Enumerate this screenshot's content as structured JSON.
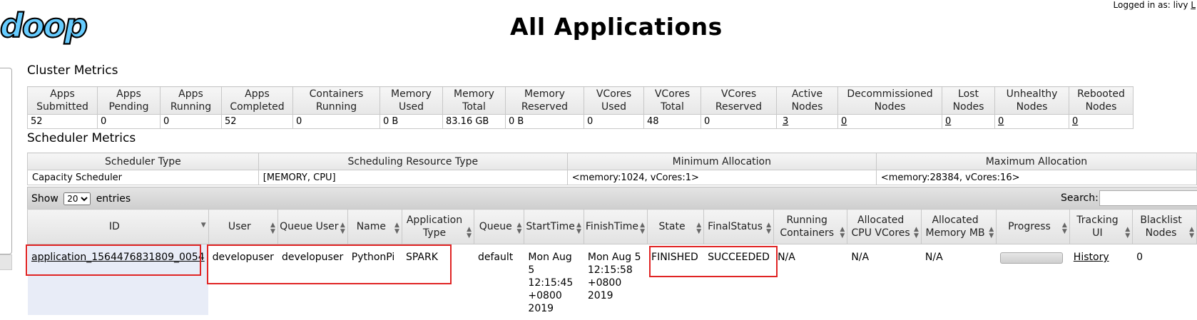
{
  "header": {
    "logo_text": "doop",
    "title": "All Applications",
    "login_prefix": "Logged in as: livy",
    "login_link": "L"
  },
  "cluster_metrics": {
    "heading": "Cluster Metrics",
    "columns": [
      {
        "l1": "Apps",
        "l2": "Submitted"
      },
      {
        "l1": "Apps",
        "l2": "Pending"
      },
      {
        "l1": "Apps",
        "l2": "Running"
      },
      {
        "l1": "Apps",
        "l2": "Completed"
      },
      {
        "l1": "Containers",
        "l2": "Running"
      },
      {
        "l1": "Memory",
        "l2": "Used"
      },
      {
        "l1": "Memory",
        "l2": "Total"
      },
      {
        "l1": "Memory",
        "l2": "Reserved"
      },
      {
        "l1": "VCores",
        "l2": "Used"
      },
      {
        "l1": "VCores",
        "l2": "Total"
      },
      {
        "l1": "VCores",
        "l2": "Reserved"
      },
      {
        "l1": "Active",
        "l2": "Nodes"
      },
      {
        "l1": "Decommissioned",
        "l2": "Nodes"
      },
      {
        "l1": "Lost",
        "l2": "Nodes"
      },
      {
        "l1": "Unhealthy",
        "l2": "Nodes"
      },
      {
        "l1": "Rebooted",
        "l2": "Nodes"
      }
    ],
    "values": [
      "52",
      "0",
      "0",
      "52",
      "0",
      "0 B",
      "83.16 GB",
      "0 B",
      "0",
      "48",
      "0",
      "3",
      "0",
      "0",
      "0",
      "0"
    ]
  },
  "scheduler_metrics": {
    "heading": "Scheduler Metrics",
    "columns": [
      "Scheduler Type",
      "Scheduling Resource Type",
      "Minimum Allocation",
      "Maximum Allocation"
    ],
    "values": [
      "Capacity Scheduler",
      "[MEMORY, CPU]",
      "<memory:1024, vCores:1>",
      "<memory:28384, vCores:16>"
    ]
  },
  "apps_toolbar": {
    "show_label": "Show",
    "entries_label": "entries",
    "page_size": "20",
    "search_label": "Search:",
    "search_value": ""
  },
  "apps_table": {
    "columns": [
      {
        "l1": "ID",
        "l2": ""
      },
      {
        "l1": "User",
        "l2": ""
      },
      {
        "l1": "Queue User",
        "l2": ""
      },
      {
        "l1": "Name",
        "l2": ""
      },
      {
        "l1": "Application",
        "l2": "Type"
      },
      {
        "l1": "Queue",
        "l2": ""
      },
      {
        "l1": "StartTime",
        "l2": ""
      },
      {
        "l1": "FinishTime",
        "l2": ""
      },
      {
        "l1": "State",
        "l2": ""
      },
      {
        "l1": "FinalStatus",
        "l2": ""
      },
      {
        "l1": "Running",
        "l2": "Containers"
      },
      {
        "l1": "Allocated",
        "l2": "CPU VCores"
      },
      {
        "l1": "Allocated",
        "l2": "Memory MB"
      },
      {
        "l1": "Progress",
        "l2": ""
      },
      {
        "l1": "Tracking",
        "l2": "UI"
      },
      {
        "l1": "Blacklist",
        "l2": "Nodes"
      }
    ],
    "rows": [
      {
        "id": "application_1564476831809_0054",
        "user": "developuser",
        "queue_user": "developuser",
        "name": "PythonPi",
        "type": "SPARK",
        "queue": "default",
        "start_time": "Mon Aug 5 12:15:45 +0800 2019",
        "finish_time": "Mon Aug 5 12:15:58 +0800 2019",
        "state": "FINISHED",
        "final_status": "SUCCEEDED",
        "running_containers": "N/A",
        "alloc_vcores": "N/A",
        "alloc_memory": "N/A",
        "progress": 0,
        "tracking_ui": "History",
        "blacklist_nodes": "0"
      }
    ]
  },
  "colors": {
    "highlight": "#e02424",
    "logo_fill": "#66ccff",
    "header_gradient_top": "#f6f6f6",
    "header_gradient_bottom": "#e7e7e7"
  }
}
